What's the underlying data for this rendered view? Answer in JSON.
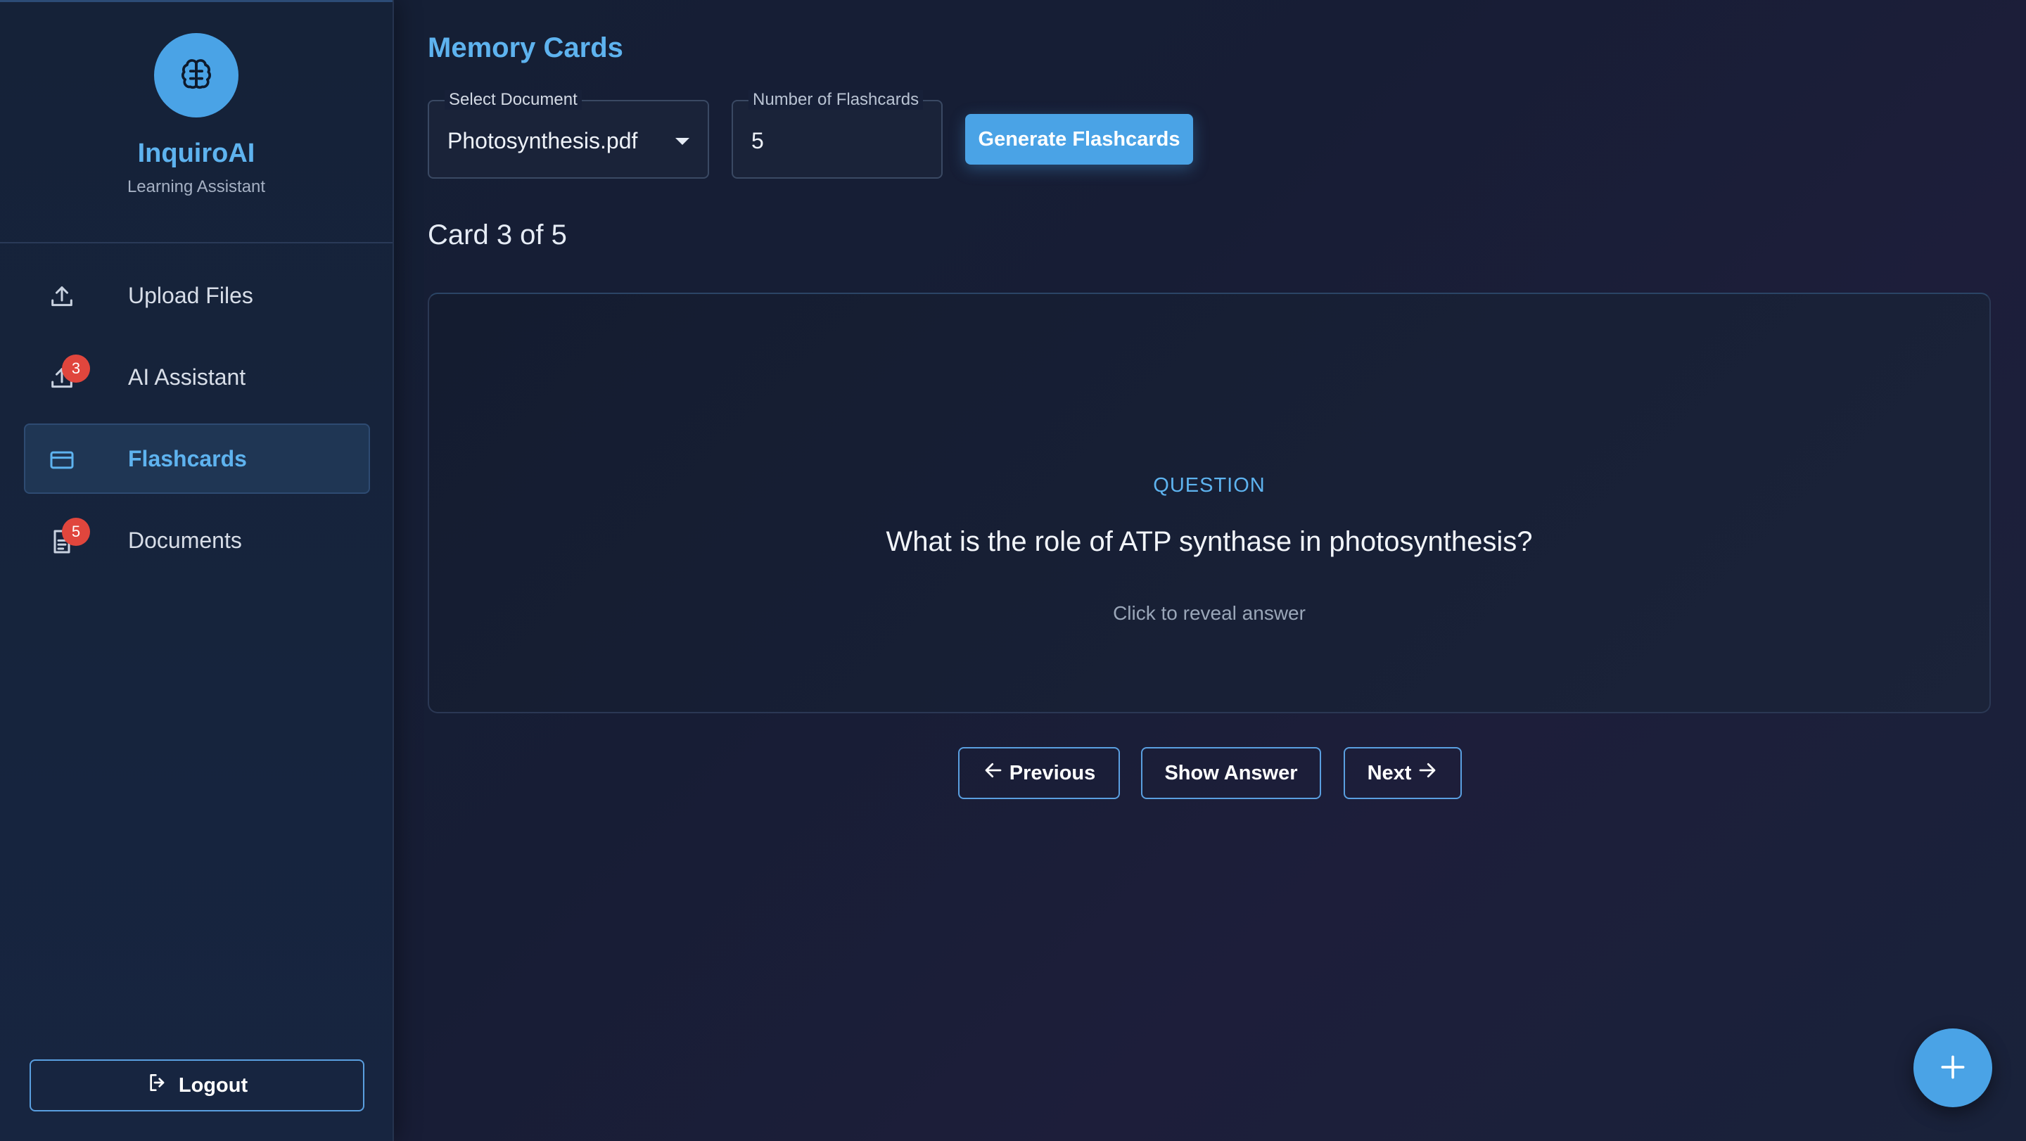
{
  "sidebar": {
    "logo_icon": "brain-icon",
    "brand": "InquiroAI",
    "tagline": "Learning Assistant",
    "items": [
      {
        "label": "Upload Files",
        "icon": "upload-icon",
        "badge": null
      },
      {
        "label": "AI Assistant",
        "icon": "upload-icon",
        "badge": "3"
      },
      {
        "label": "Flashcards",
        "icon": "card-icon",
        "badge": null,
        "active": true
      },
      {
        "label": "Documents",
        "icon": "document-icon",
        "badge": "5"
      }
    ],
    "logout_label": "Logout"
  },
  "main": {
    "title": "Memory Cards",
    "select_document": {
      "label": "Select Document",
      "value": "Photosynthesis.pdf"
    },
    "num_flashcards": {
      "label": "Number of Flashcards",
      "value": "5"
    },
    "generate_label": "Generate Flashcards",
    "card_counter": "Card 3 of 5",
    "card": {
      "label": "QUESTION",
      "question": "What is the role of ATP synthase in photosynthesis?",
      "hint": "Click to reveal answer"
    },
    "buttons": {
      "previous": "Previous",
      "show_answer": "Show Answer",
      "next": "Next"
    },
    "fab_icon": "plus-icon"
  },
  "colors": {
    "accent": "#4aa3e6",
    "accent_text": "#5eb3ef",
    "badge": "#e0463d",
    "background": "#161c30"
  }
}
